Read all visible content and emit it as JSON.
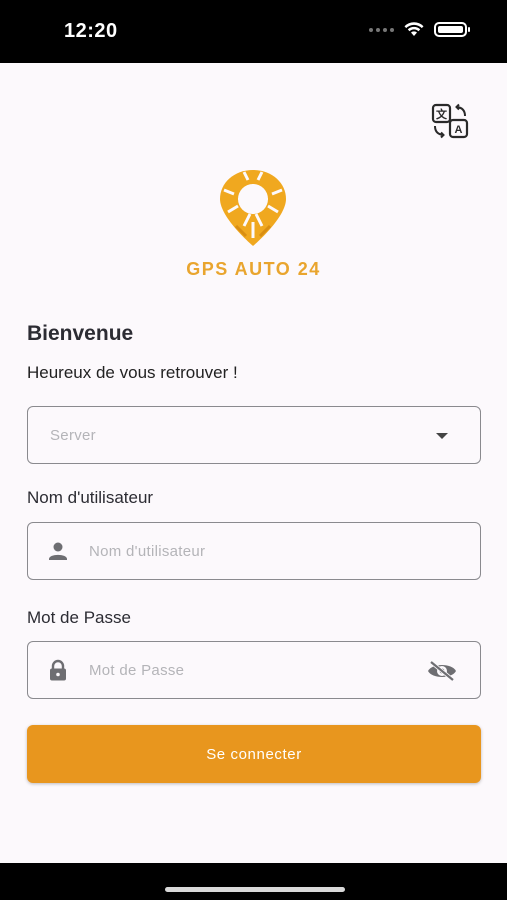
{
  "status_bar": {
    "time": "12:20"
  },
  "header": {
    "language_icon": "translate-icon"
  },
  "brand": {
    "name": "GPS AUTO 24",
    "logo_icon": "map-pin-logo",
    "color": "#e9a52e"
  },
  "welcome": {
    "title": "Bienvenue",
    "subtitle": "Heureux de vous retrouver !"
  },
  "form": {
    "server": {
      "placeholder": "Server",
      "value": "",
      "icon": "chevron-down-icon"
    },
    "username": {
      "label": "Nom d'utilisateur",
      "placeholder": "Nom d'utilisateur",
      "value": "",
      "icon": "person-icon"
    },
    "password": {
      "label": "Mot de Passe",
      "placeholder": "Mot de Passe",
      "value": "",
      "icon": "lock-icon",
      "toggle_icon": "eye-off-icon"
    },
    "submit_label": "Se connecter"
  },
  "colors": {
    "accent": "#e8961e",
    "background": "#fcf9fc",
    "text": "#2c2c33"
  }
}
